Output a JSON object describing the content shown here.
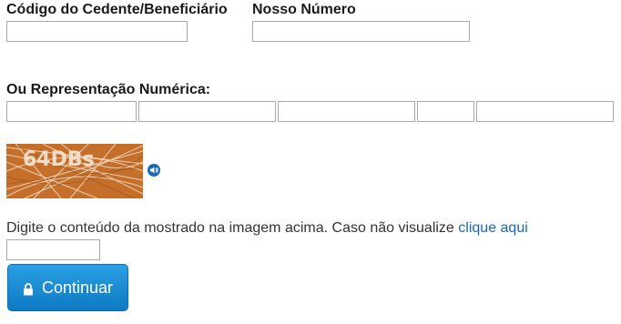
{
  "labels": {
    "cedente": "Código do Cedente/Beneficiário",
    "nosso_numero": "Nosso Número",
    "representacao": "Ou Representação Numérica:"
  },
  "captcha": {
    "text": "64DBs",
    "background_color": "#c66f2b",
    "audio_icon": "speaker-icon"
  },
  "instructions": {
    "text": "Digite o conteúdo da mostrado na imagem acima. Caso não visualize",
    "link": "clique aqui"
  },
  "button": {
    "label": "Continuar",
    "icon": "lock-icon",
    "color": "#1483cf"
  }
}
